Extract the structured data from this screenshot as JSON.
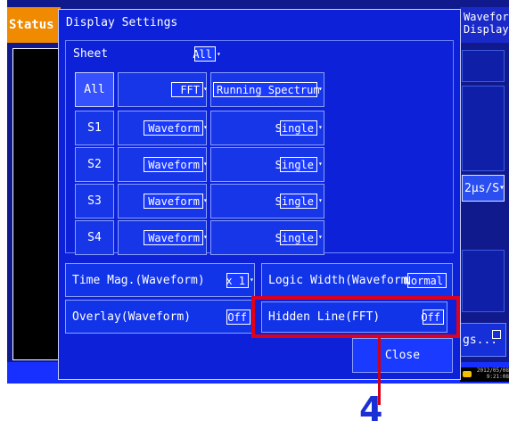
{
  "background": {
    "status_tab": "Status",
    "right_tab_line1": "Waveform",
    "right_tab_line2": "Display",
    "rate_value": "2μs/S",
    "settings_label": "gs...",
    "clock_line1": "2012/05/08",
    "clock_line2": "9:21:08"
  },
  "dialog": {
    "title": "Display Settings",
    "sheet_label": "Sheet",
    "sheet_value": "All",
    "rows": [
      {
        "label": "All",
        "type": "FFT",
        "mode": "Running Spectrum"
      },
      {
        "label": "S1",
        "type": "Waveform",
        "mode": "Single"
      },
      {
        "label": "S2",
        "type": "Waveform",
        "mode": "Single"
      },
      {
        "label": "S3",
        "type": "Waveform",
        "mode": "Single"
      },
      {
        "label": "S4",
        "type": "Waveform",
        "mode": "Single"
      }
    ],
    "time_mag_label": "Time Mag.(Waveform)",
    "time_mag_value": "x 1",
    "logic_width_label": "Logic Width(Waveform)",
    "logic_width_value": "Normal",
    "overlay_label": "Overlay(Waveform)",
    "overlay_value": "Off",
    "hidden_line_label": "Hidden Line(FFT)",
    "hidden_line_value": "Off",
    "close_label": "Close"
  },
  "callout": {
    "number": "4"
  },
  "colors": {
    "accent_orange": "#f08a00",
    "dialog_blue": "#0d22d8",
    "highlight_red": "#e0001a",
    "callout_blue": "#1b2fd6"
  },
  "icons": {
    "dropdown": "chevron-down-icon",
    "clock": "clock-icon",
    "window": "window-square-icon"
  }
}
